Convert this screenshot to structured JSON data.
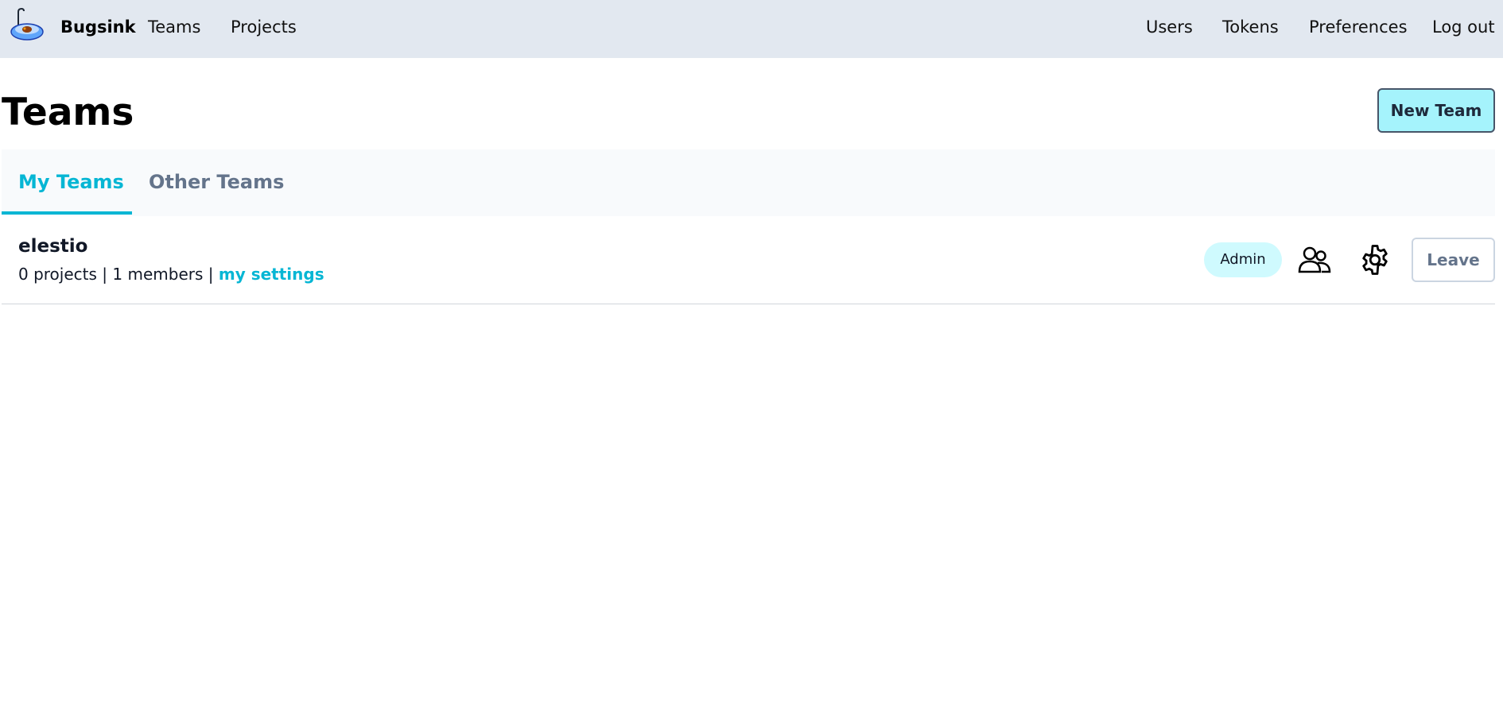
{
  "nav": {
    "brand": "Bugsink",
    "logo_icon": "bugsink-sink-logo",
    "left_links": [
      "Teams",
      "Projects"
    ],
    "right_links": [
      "Users",
      "Tokens",
      "Preferences",
      "Log out"
    ]
  },
  "page": {
    "title": "Teams",
    "new_team_label": "New Team"
  },
  "tabs": [
    {
      "label": "My Teams",
      "active": true
    },
    {
      "label": "Other Teams",
      "active": false
    }
  ],
  "teams": [
    {
      "name": "elestio",
      "projects": "0 projects",
      "members": "1 members",
      "separator": "|",
      "settings_link": "my settings",
      "role_badge": "Admin",
      "members_icon": "users-icon",
      "settings_icon": "gear-icon",
      "leave_label": "Leave"
    }
  ],
  "colors": {
    "accent": "#06b6d4",
    "topbar": "#e2e8f0",
    "badge_bg": "#cffafe",
    "new_team_bg": "#a5f3fc"
  }
}
